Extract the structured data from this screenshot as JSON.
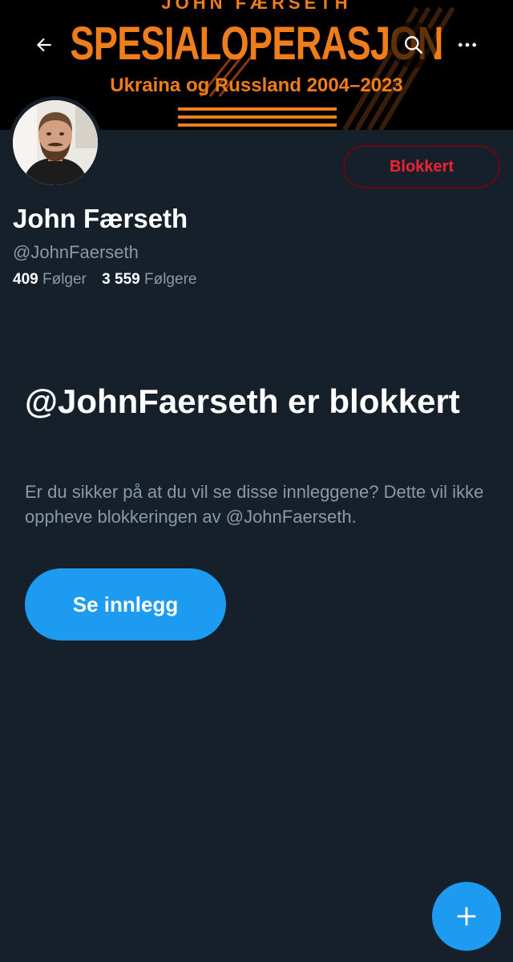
{
  "banner": {
    "kicker": "JOHN FÆRSETH",
    "title": "SPESIALOPERASJON",
    "subtitle": "Ukraina og Russland 2004–2023",
    "accent_color": "#ef7d1a"
  },
  "header_actions": {
    "back_icon": "arrow-left-icon",
    "search_icon": "search-icon",
    "more_icon": "more-horizontal-icon"
  },
  "profile": {
    "display_name": "John Færseth",
    "handle": "@JohnFaerseth",
    "blocked_label": "Blokkert",
    "following_count": "409",
    "following_label": "Følger",
    "followers_count": "3 559",
    "followers_label": "Følgere"
  },
  "blocked_notice": {
    "heading": "@JohnFaerseth er blokkert",
    "description": "Er du sikker på at du vil se disse innleggene? Dette vil ikke oppheve blokkeringen av @JohnFaerseth.",
    "button_label": "Se innlegg"
  },
  "fab": {
    "icon": "plus-icon"
  },
  "colors": {
    "background": "#15202b",
    "primary": "#1d9bf0",
    "danger": "#f4212e",
    "secondary_text": "#8b98a5"
  }
}
